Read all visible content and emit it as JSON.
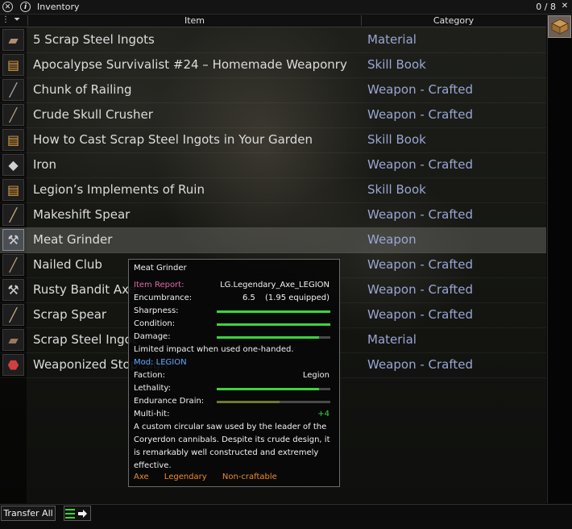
{
  "window": {
    "title": "Inventory",
    "count": "0 / 8"
  },
  "header": {
    "filter": "⋮ ⏷",
    "col_item": "Item",
    "col_category": "Category"
  },
  "rows": [
    {
      "name": "5 Scrap Steel Ingots",
      "category": "Material",
      "icon": "ingot-stack-icon"
    },
    {
      "name": "Apocalypse Survivalist #24 – Homemade Weaponry",
      "category": "Skill Book",
      "icon": "book-icon"
    },
    {
      "name": "Chunk of Railing",
      "category": "Weapon - Crafted",
      "icon": "railing-icon"
    },
    {
      "name": "Crude Skull Crusher",
      "category": "Weapon - Crafted",
      "icon": "club-icon"
    },
    {
      "name": "How to Cast Scrap Steel Ingots in Your Garden",
      "category": "Skill Book",
      "icon": "book-icon"
    },
    {
      "name": "Iron",
      "category": "Weapon - Crafted",
      "icon": "iron-icon"
    },
    {
      "name": "Legion’s Implements of Ruin",
      "category": "Skill Book",
      "icon": "book-icon"
    },
    {
      "name": "Makeshift Spear",
      "category": "Weapon - Crafted",
      "icon": "spear-icon"
    },
    {
      "name": "Meat Grinder",
      "category": "Weapon",
      "icon": "axe-icon",
      "selected": true
    },
    {
      "name": "Nailed Club",
      "category": "Weapon - Crafted",
      "icon": "club-icon"
    },
    {
      "name": "Rusty Bandit Axe",
      "category": "Weapon - Crafted",
      "icon": "axe-icon"
    },
    {
      "name": "Scrap Spear",
      "category": "Weapon - Crafted",
      "icon": "spear-icon"
    },
    {
      "name": "Scrap Steel Ingot",
      "category": "Material",
      "icon": "ingot-icon"
    },
    {
      "name": "Weaponized Stop Sign",
      "category": "Weapon - Crafted",
      "icon": "stop-sign-icon"
    }
  ],
  "tooltip": {
    "title": "Meat Grinder",
    "item_report_label": "Item Report:",
    "item_report_value": "LG.Legendary_Axe_LEGION",
    "encumbrance_label": "Encumbrance:",
    "encumbrance_value": "6.5",
    "encumbrance_equipped": "(1.95 equipped)",
    "sharpness_label": "Sharpness:",
    "sharpness": 1.0,
    "condition_label": "Condition:",
    "condition": 1.0,
    "damage_label": "Damage:",
    "damage": 0.9,
    "note": "Limited impact when used one-handed.",
    "mod": "Mod: LEGION",
    "faction_label": "Faction:",
    "faction_value": "Legion",
    "lethality_label": "Lethality:",
    "lethality": 0.9,
    "endurance_label": "Endurance Drain:",
    "endurance": 0.55,
    "multihit_label": "Multi-hit:",
    "multihit_value": "+4",
    "description": "A custom circular saw used by the leader of the Coryerdon cannibals. Despite its crude design, it is remarkably well constructed and extremely effective.",
    "tag_axe": "Axe",
    "tag_legendary": "Legendary",
    "tag_craft": "Non-craftable"
  },
  "footer": {
    "transfer_all": "Transfer All"
  },
  "colors": {
    "category": "#9aa6d4",
    "bar_green": "#3dd43d",
    "tag_orange": "#ee8a2a",
    "report_pink": "#e066a8",
    "mod_blue": "#5fa8ff",
    "multihit_green": "#3dd43d"
  }
}
